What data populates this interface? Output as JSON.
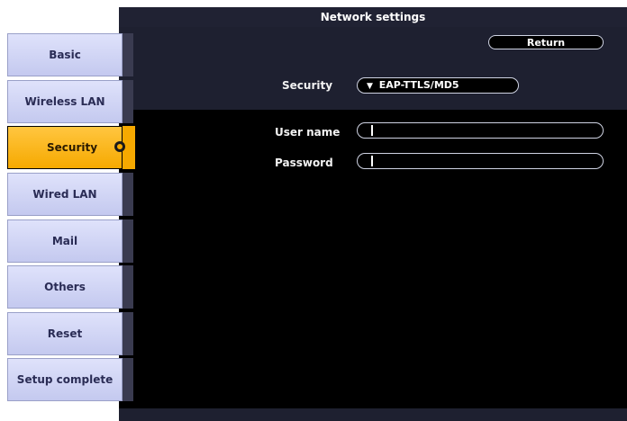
{
  "window": {
    "title": "Network settings"
  },
  "actions": {
    "return_label": "Return"
  },
  "security": {
    "label": "Security",
    "selected": "EAP-TTLS/MD5",
    "arrow_glyph": "▼"
  },
  "fields": {
    "username_label": "User name",
    "username_value": "",
    "password_label": "Password",
    "password_value": ""
  },
  "sidebar": {
    "items": [
      {
        "label": "Basic"
      },
      {
        "label": "Wireless LAN"
      },
      {
        "label": "Security",
        "active": true
      },
      {
        "label": "Wired LAN"
      },
      {
        "label": "Mail"
      },
      {
        "label": "Others"
      },
      {
        "label": "Reset"
      },
      {
        "label": "Setup complete"
      }
    ]
  },
  "colors": {
    "accent": "#f6a900",
    "menu_bg": "#c4c9ef",
    "panel_bg": "#000000",
    "title_bg": "#202233"
  }
}
